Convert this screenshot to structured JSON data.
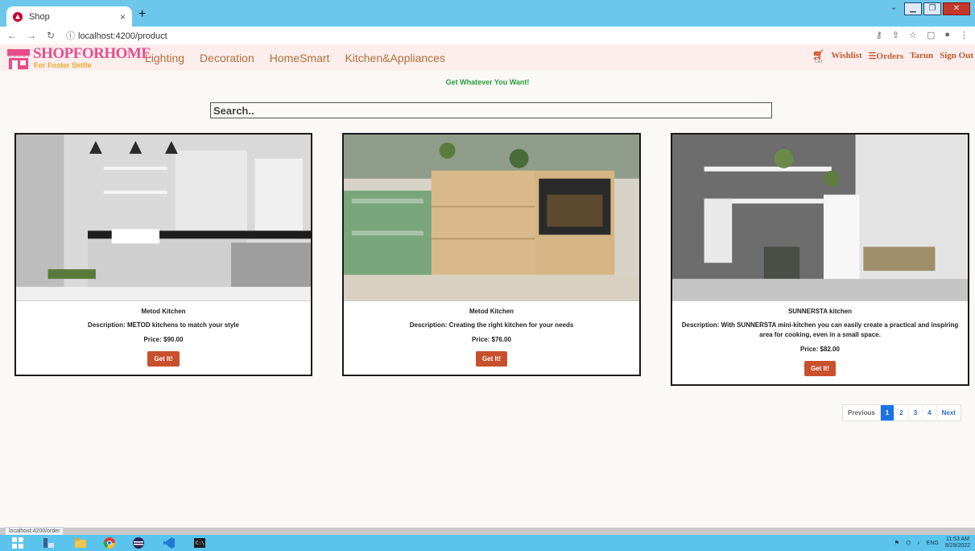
{
  "browser": {
    "tab_title": "Shop",
    "tab_close": "×",
    "new_tab": "+",
    "url": "localhost:4200/product",
    "status_url": "localhost:4200/order"
  },
  "header": {
    "logo_text": "SHOPFORHOME",
    "logo_sub": "For Foster Settle",
    "nav": [
      "Lighting",
      "Decoration",
      "HomeSmart",
      "Kitchen&Appliances"
    ],
    "cart_label": "Cart",
    "wishlist": "Wishlist",
    "orders": "Orders",
    "user": "Tarun",
    "signout": "Sign Out"
  },
  "tagline": "Get Whatever You Want!",
  "search": {
    "value": "Search..",
    "placeholder": "Search.."
  },
  "products": [
    {
      "name": "Metod Kitchen",
      "description": "Description: METOD kitchens to match your style",
      "price": "Price: $90.00",
      "button": "Get It!"
    },
    {
      "name": "Metod Kitchen",
      "description": "Description: Creating the right kitchen for your needs",
      "price": "Price: $76.00",
      "button": "Get It!"
    },
    {
      "name": "SUNNERSTA kitchen",
      "description": "Description: With SUNNERSTA mini-kitchen you can easily create a practical and inspiring area for cooking, even in a small space.",
      "price": "Price: $82.00",
      "button": "Get It!"
    }
  ],
  "pagination": {
    "previous": "Previous",
    "pages": [
      "1",
      "2",
      "3",
      "4"
    ],
    "active_page": "1",
    "next": "Next"
  },
  "taskbar": {
    "lang": "ENG",
    "time": "11:53 AM",
    "date": "8/29/2022"
  },
  "colors": {
    "accent": "#c8502d",
    "nav_text": "#b06f37",
    "tagline": "#2a9a3c",
    "taskbar": "#5ac4ec"
  }
}
